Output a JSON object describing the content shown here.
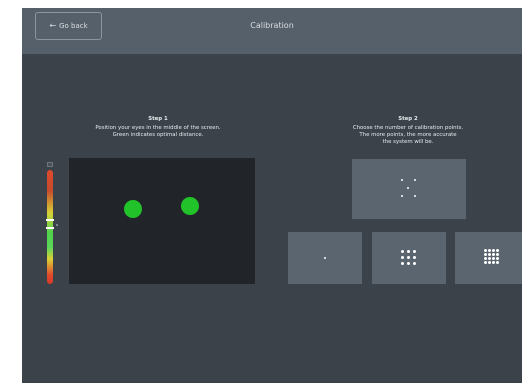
{
  "header": {
    "back_label": "Go back",
    "back_icon": "arrow-left-icon",
    "title": "Calibration"
  },
  "step1": {
    "heading": "Step 1",
    "line1": "Position your eyes in the middle of the screen.",
    "line2": "Green indicates optimal distance."
  },
  "step2": {
    "heading": "Step 2",
    "line1": "Choose the number of calibration points.",
    "line2": "The more points, the more accurate",
    "line3": "the system will be."
  },
  "calibration_options": [
    5,
    1,
    9,
    16
  ],
  "colors": {
    "background": "#3b4249",
    "topbar": "#56606a",
    "panel": "#5b6570",
    "camera_view": "#212428",
    "eye_indicator": "#22c22a"
  }
}
